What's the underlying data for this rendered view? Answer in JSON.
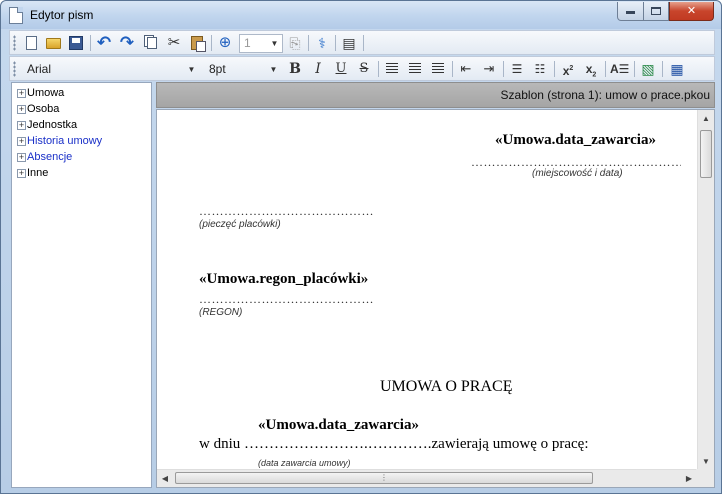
{
  "window": {
    "title": "Edytor pism"
  },
  "toolbar1": {
    "page_number": "1",
    "icons": [
      "new-document-icon",
      "open-folder-icon",
      "save-icon",
      "undo-icon",
      "redo-icon",
      "copy-icon",
      "cut-icon",
      "paste-icon",
      "add-page-icon",
      "page-select-combo",
      "delete-page-icon",
      "field-tool-icon",
      "template-icon"
    ]
  },
  "toolbar2": {
    "font_name": "Arial",
    "font_size": "8pt",
    "bold_label": "B",
    "italic_label": "I",
    "underline_label": "U",
    "strike_label": "S"
  },
  "tree": {
    "items": [
      {
        "label": "Umowa",
        "color": "#000000"
      },
      {
        "label": "Osoba",
        "color": "#000000"
      },
      {
        "label": "Jednostka",
        "color": "#000000"
      },
      {
        "label": "Historia umowy",
        "color": "#1a30c8"
      },
      {
        "label": "Absencje",
        "color": "#1a30c8"
      },
      {
        "label": "Inne",
        "color": "#000000"
      }
    ]
  },
  "doc": {
    "header": "Szablon (strona 1):  umow o prace.pkou",
    "date_field": "«Umowa.data_zawarcia»",
    "date_dots": "……………………………………………",
    "date_hint": "(miejscowość i data)",
    "stamp_dots": "……………………………………",
    "stamp_hint": "(pieczęć placówki)",
    "regon_field": "«Umowa.regon_placówki»",
    "regon_dots": "……………………………………",
    "regon_hint": "(REGON)",
    "heading": "UMOWA O PRACĘ",
    "date_field2": "«Umowa.data_zawarcia»",
    "line_prefix": "w dniu",
    "line_dots": "…………………….………….",
    "line_suffix": "zawierają umowę o pracę:",
    "line_hint": "(data zawarcia umowy)"
  }
}
